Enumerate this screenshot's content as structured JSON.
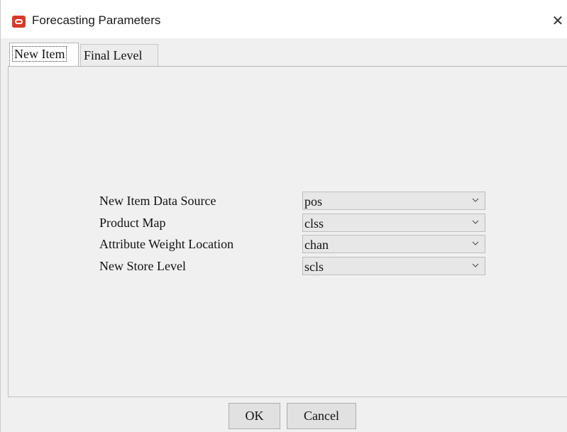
{
  "window": {
    "title": "Forecasting Parameters",
    "close_glyph": "✕"
  },
  "tabs": [
    {
      "label": "New Item",
      "selected": true
    },
    {
      "label": "Final Level",
      "selected": false
    }
  ],
  "form": {
    "rows": [
      {
        "label": "New Item Data Source",
        "value": "pos"
      },
      {
        "label": "Product Map",
        "value": "clss"
      },
      {
        "label": "Attribute Weight Location",
        "value": "chan"
      },
      {
        "label": "New Store Level",
        "value": "scls"
      }
    ]
  },
  "buttons": {
    "ok_label": "OK",
    "cancel_label": "Cancel"
  },
  "icons": {
    "app": "oracle-logo-icon",
    "close": "close-icon",
    "dropdown": "chevron-down-icon"
  },
  "colors": {
    "brand": "#d63a2a",
    "dialog_background": "#f0f0f0",
    "dropdown_background": "#e7e7e7",
    "button_background": "#e1e1e1"
  }
}
